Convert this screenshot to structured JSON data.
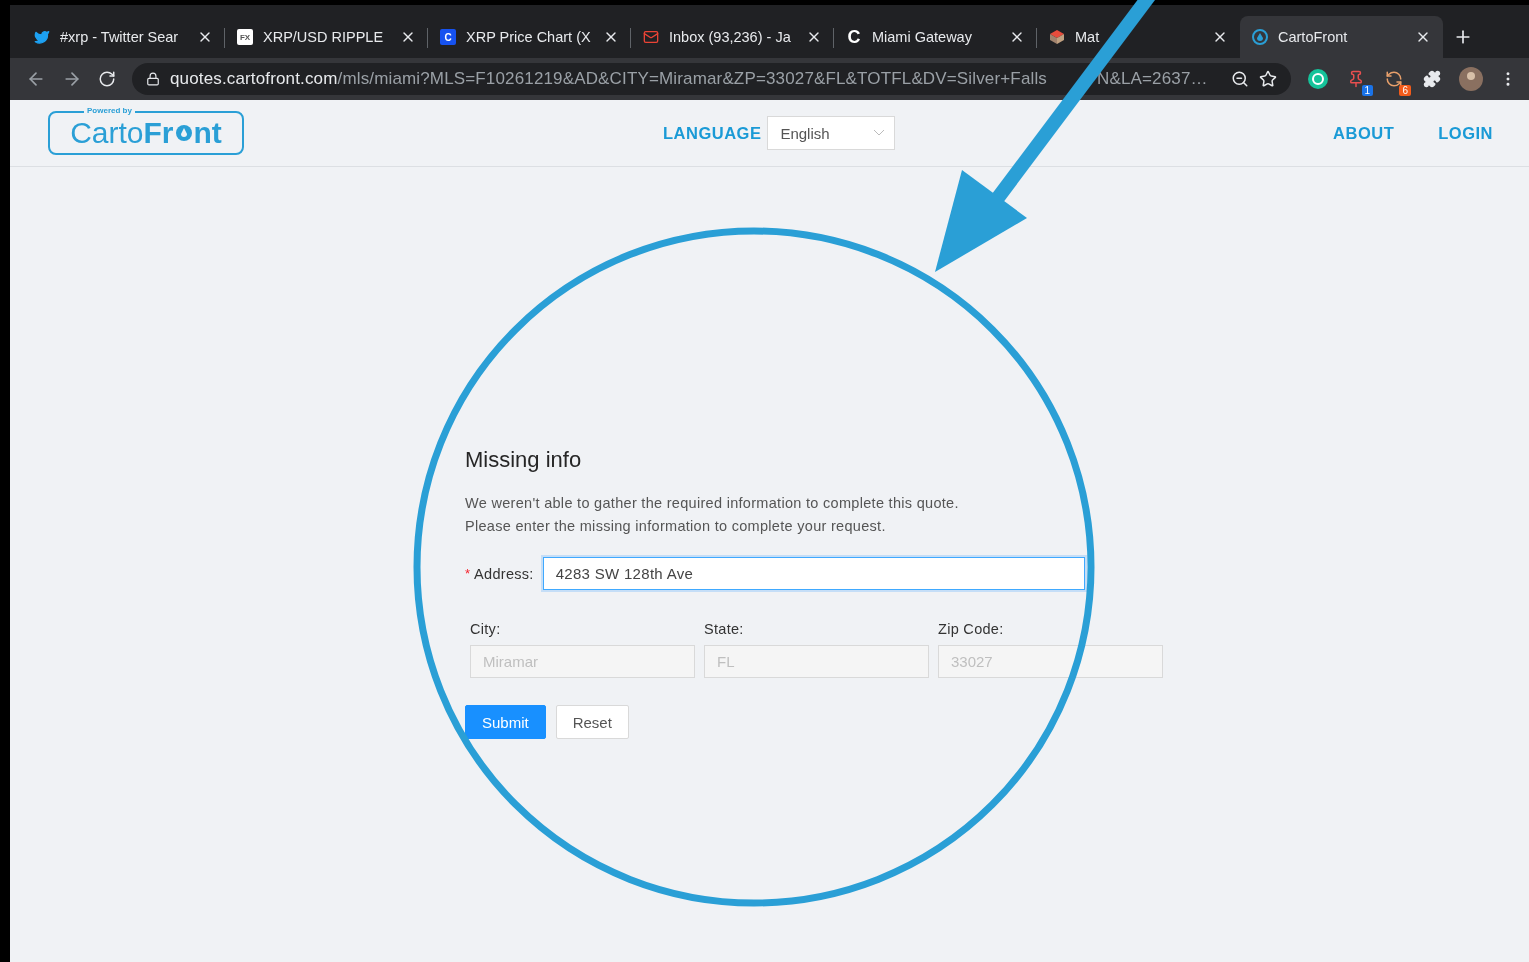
{
  "browser": {
    "tabs": [
      {
        "title": "#xrp - Twitter Sear",
        "selected": false
      },
      {
        "title": "XRP/USD RIPPLE",
        "favicon_text": "FX",
        "selected": false
      },
      {
        "title": "XRP Price Chart (X",
        "favicon_text": "C",
        "selected": false
      },
      {
        "title": "Inbox (93,236) - Ja",
        "selected": false
      },
      {
        "title": "Miami Gateway",
        "favicon_text": "C",
        "selected": false
      },
      {
        "title": "Mat",
        "selected": false
      },
      {
        "title": "CartoFront",
        "selected": true
      }
    ],
    "url_host": "quotes.cartofront.com",
    "url_path": "/mls/miami?MLS=F10261219&AD&CITY=Miramar&ZP=33027&FL&TOTFL&DV=Silver+Falls",
    "url_tail": "N&LA=2637…",
    "extension_badges": [
      "1",
      "6"
    ]
  },
  "header": {
    "logo_tagline": "Powered by",
    "logo_light": "Carto",
    "logo_bold": "Fr",
    "logo_bold_end": "nt",
    "language_label": "LANGUAGE",
    "language_value": "English",
    "nav": [
      "ABOUT",
      "LOGIN"
    ]
  },
  "form": {
    "title": "Missing info",
    "lines": [
      "We weren't able to gather the required information to complete this quote.",
      "Please enter the missing information to complete your request."
    ],
    "address": {
      "required_mark": "*",
      "label": "Address:",
      "value": "4283 SW 128th Ave",
      "focused": true
    },
    "fields": [
      {
        "label": "City:",
        "placeholder": "Miramar",
        "disabled": true
      },
      {
        "label": "State:",
        "placeholder": "FL",
        "disabled": true
      },
      {
        "label": "Zip Code:",
        "placeholder": "33027",
        "disabled": true
      }
    ],
    "buttons": [
      {
        "label": "Submit",
        "kind": "primary"
      },
      {
        "label": "Reset",
        "kind": "default"
      }
    ]
  }
}
